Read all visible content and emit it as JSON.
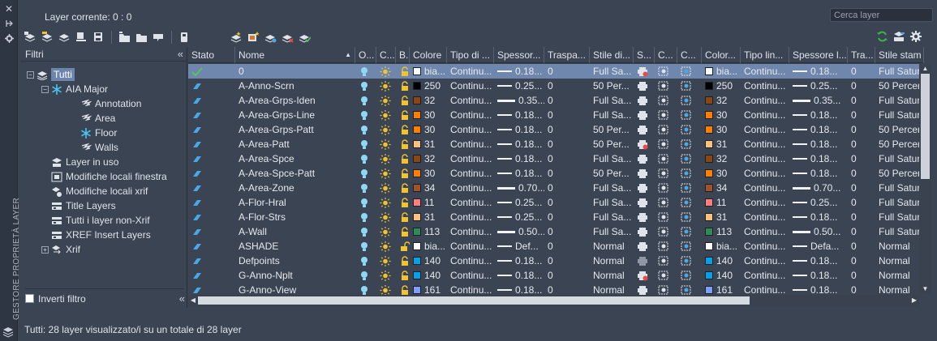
{
  "palette_title": "GESTORE PROPRIETÀ LAYER",
  "current_layer": "Layer corrente: 0 : 0",
  "search": {
    "placeholder": "Cerca layer"
  },
  "filters": {
    "header": "Filtri",
    "tree": [
      {
        "label": "Tutti",
        "level": 0,
        "expander": "−",
        "icon": "layers-icon",
        "selected": true
      },
      {
        "label": "AIA Major",
        "level": 1,
        "expander": "−",
        "icon": "snowflake-icon"
      },
      {
        "label": "Annotation",
        "level": 2,
        "icon": "layer-filter-icon"
      },
      {
        "label": "Area",
        "level": 2,
        "icon": "layer-filter-icon"
      },
      {
        "label": "Floor",
        "level": 2,
        "icon": "snowflake-icon"
      },
      {
        "label": "Walls",
        "level": 2,
        "icon": "layer-filter-icon"
      },
      {
        "label": "Layer in uso",
        "level": 1,
        "icon": "layers-in-use-icon"
      },
      {
        "label": "Modifiche locali finestra",
        "level": 1,
        "icon": "viewport-override-icon"
      },
      {
        "label": "Modifiche locali xrif",
        "level": 1,
        "icon": "xref-override-icon"
      },
      {
        "label": "Title Layers",
        "level": 1,
        "icon": "group-filter-icon"
      },
      {
        "label": "Tutti i layer non-Xrif",
        "level": 1,
        "icon": "group-filter-icon"
      },
      {
        "label": "XREF Insert Layers",
        "level": 1,
        "icon": "group-filter-icon"
      },
      {
        "label": "Xrif",
        "level": 1,
        "expander": "+",
        "icon": "xref-icon"
      }
    ],
    "invert_label": "Inverti filtro",
    "invert_checked": false
  },
  "columns": [
    "Stato",
    "Nome",
    "O...",
    "C...",
    "B.",
    "Colore",
    "Tipo di ...",
    "Spessor...",
    "Traspa...",
    "Stile di...",
    "S...",
    "C...",
    "C...",
    "Color...",
    "Tipo lin...",
    "Spessore l...",
    "Tra...",
    "Stile stam"
  ],
  "layers": [
    {
      "name": "0",
      "current": true,
      "color": "#ffffff",
      "color_label": "bia...",
      "linetype": "Continu...",
      "lw": "0.18...",
      "lw_thick": false,
      "transp": "0",
      "plot_style": "Full Sa...",
      "vp_color": "#ffffff",
      "vp_color_label": "bia...",
      "vp_linetype": "Continu...",
      "vp_lw": "0.18...",
      "vp_lw_thick": false,
      "vp_transp": "0",
      "vp_plot_style": "Full Satur",
      "plot": "noplot",
      "locked": true,
      "selected": true
    },
    {
      "name": "A-Anno-Scrn",
      "color": "#000000",
      "color_label": "250",
      "linetype": "Continu...",
      "lw": "0.25...",
      "lw_thick": false,
      "transp": "0",
      "plot_style": "50 Per...",
      "vp_color": "#000000",
      "vp_color_label": "250",
      "vp_linetype": "Continu...",
      "vp_lw": "0.25...",
      "vp_lw_thick": false,
      "vp_transp": "0",
      "vp_plot_style": "50 Percer",
      "plot": "plot",
      "locked": true
    },
    {
      "name": "A-Area-Grps-Iden",
      "color": "#8b4513",
      "color_label": "32",
      "linetype": "Continu...",
      "lw": "0.35...",
      "lw_thick": true,
      "transp": "0",
      "plot_style": "Full Sa...",
      "vp_color": "#8b4513",
      "vp_color_label": "32",
      "vp_linetype": "Continu...",
      "vp_lw": "0.35...",
      "vp_lw_thick": true,
      "vp_transp": "0",
      "vp_plot_style": "Full Satur",
      "plot": "plot",
      "locked": true
    },
    {
      "name": "A-Area-Grps-Line",
      "color": "#ff7f00",
      "color_label": "30",
      "linetype": "Continu...",
      "lw": "0.18...",
      "lw_thick": false,
      "transp": "0",
      "plot_style": "Full Sa...",
      "vp_color": "#ff7f00",
      "vp_color_label": "30",
      "vp_linetype": "Continu...",
      "vp_lw": "0.18...",
      "vp_lw_thick": false,
      "vp_transp": "0",
      "vp_plot_style": "Full Satur",
      "plot": "plot",
      "locked": true
    },
    {
      "name": "A-Area-Grps-Patt",
      "color": "#ff7f00",
      "color_label": "30",
      "linetype": "Continu...",
      "lw": "0.18...",
      "lw_thick": false,
      "transp": "0",
      "plot_style": "50 Per...",
      "vp_color": "#ff7f00",
      "vp_color_label": "30",
      "vp_linetype": "Continu...",
      "vp_lw": "0.18...",
      "vp_lw_thick": false,
      "vp_transp": "0",
      "vp_plot_style": "50 Percer",
      "plot": "plot",
      "locked": true
    },
    {
      "name": "A-Area-Patt",
      "color": "#ffbf7f",
      "color_label": "31",
      "linetype": "Continu...",
      "lw": "0.18...",
      "lw_thick": false,
      "transp": "0",
      "plot_style": "50 Per...",
      "vp_color": "#ffbf7f",
      "vp_color_label": "31",
      "vp_linetype": "Continu...",
      "vp_lw": "0.18...",
      "vp_lw_thick": false,
      "vp_transp": "0",
      "vp_plot_style": "50 Percer",
      "plot": "noplot",
      "locked": true
    },
    {
      "name": "A-Area-Spce",
      "color": "#8b4513",
      "color_label": "32",
      "linetype": "Continu...",
      "lw": "0.18...",
      "lw_thick": false,
      "transp": "0",
      "plot_style": "Full Sa...",
      "vp_color": "#8b4513",
      "vp_color_label": "32",
      "vp_linetype": "Continu...",
      "vp_lw": "0.18...",
      "vp_lw_thick": false,
      "vp_transp": "0",
      "vp_plot_style": "Full Satur",
      "plot": "plot",
      "locked": true
    },
    {
      "name": "A-Area-Spce-Patt",
      "color": "#ff7f00",
      "color_label": "30",
      "linetype": "Continu...",
      "lw": "0.18...",
      "lw_thick": false,
      "transp": "0",
      "plot_style": "50 Per...",
      "vp_color": "#ff7f00",
      "vp_color_label": "30",
      "vp_linetype": "Continu...",
      "vp_lw": "0.18...",
      "vp_lw_thick": false,
      "vp_transp": "0",
      "vp_plot_style": "50 Percer",
      "plot": "plot",
      "locked": true
    },
    {
      "name": "A-Area-Zone",
      "color": "#a0522d",
      "color_label": "34",
      "linetype": "Continu...",
      "lw": "0.70...",
      "lw_thick": true,
      "transp": "0",
      "plot_style": "Full Sa...",
      "vp_color": "#a0522d",
      "vp_color_label": "34",
      "vp_linetype": "Continu...",
      "vp_lw": "0.70...",
      "vp_lw_thick": true,
      "vp_transp": "0",
      "vp_plot_style": "Full Satur",
      "plot": "plot",
      "locked": true
    },
    {
      "name": "A-Flor-Hral",
      "color": "#ff7f7f",
      "color_label": "11",
      "linetype": "Continu...",
      "lw": "0.25...",
      "lw_thick": false,
      "transp": "0",
      "plot_style": "Full Sa...",
      "vp_color": "#ff7f7f",
      "vp_color_label": "11",
      "vp_linetype": "Continu...",
      "vp_lw": "0.25...",
      "vp_lw_thick": false,
      "vp_transp": "0",
      "vp_plot_style": "Full Satur",
      "plot": "plot",
      "locked": true
    },
    {
      "name": "A-Flor-Strs",
      "color": "#ffbf7f",
      "color_label": "31",
      "linetype": "Continu...",
      "lw": "0.25...",
      "lw_thick": false,
      "transp": "0",
      "plot_style": "Full Sa...",
      "vp_color": "#ffbf7f",
      "vp_color_label": "31",
      "vp_linetype": "Continu...",
      "vp_lw": "0.18...",
      "vp_lw_thick": false,
      "vp_transp": "0",
      "vp_plot_style": "Full Satur",
      "plot": "plot",
      "locked": true
    },
    {
      "name": "A-Wall",
      "color": "#2e8b57",
      "color_label": "113",
      "linetype": "Continu...",
      "lw": "0.50...",
      "lw_thick": true,
      "transp": "0",
      "plot_style": "Full Sa...",
      "vp_color": "#2e8b57",
      "vp_color_label": "113",
      "vp_linetype": "Continu...",
      "vp_lw": "0.50...",
      "vp_lw_thick": true,
      "vp_transp": "0",
      "vp_plot_style": "Full Satur",
      "plot": "plot",
      "locked": true
    },
    {
      "name": "ASHADE",
      "color": "#ffffff",
      "color_label": "bia...",
      "linetype": "Continu...",
      "lw": "Def...",
      "lw_thick": false,
      "transp": "0",
      "plot_style": "Normal",
      "vp_color": "#ffffff",
      "vp_color_label": "bia...",
      "vp_linetype": "Continu...",
      "vp_lw": "Defa...",
      "vp_lw_thick": false,
      "vp_transp": "0",
      "vp_plot_style": "Normal",
      "plot": "plot",
      "locked": false
    },
    {
      "name": "Defpoints",
      "color": "#0aa0e8",
      "color_label": "140",
      "linetype": "Continu...",
      "lw": "0.18...",
      "lw_thick": false,
      "transp": "0",
      "plot_style": "Normal",
      "vp_color": "#0aa0e8",
      "vp_color_label": "140",
      "vp_linetype": "Continu...",
      "vp_lw": "0.18...",
      "vp_lw_thick": false,
      "vp_transp": "0",
      "vp_plot_style": "Normal",
      "plot": "noplot-grey",
      "locked": true
    },
    {
      "name": "G-Anno-Nplt",
      "color": "#0aa0e8",
      "color_label": "140",
      "linetype": "Continu...",
      "lw": "0.18...",
      "lw_thick": false,
      "transp": "0",
      "plot_style": "Normal",
      "vp_color": "#0aa0e8",
      "vp_color_label": "140",
      "vp_linetype": "Continu...",
      "vp_lw": "0.18...",
      "vp_lw_thick": false,
      "vp_transp": "0",
      "vp_plot_style": "Normal",
      "plot": "noplot",
      "locked": true
    },
    {
      "name": "G-Anno-View",
      "color": "#7f9fff",
      "color_label": "161",
      "linetype": "Continu...",
      "lw": "0.18...",
      "lw_thick": false,
      "transp": "0",
      "plot_style": "Normal",
      "vp_color": "#7f9fff",
      "vp_color_label": "161",
      "vp_linetype": "Continu...",
      "vp_lw": "0.18...",
      "vp_lw_thick": false,
      "vp_transp": "0",
      "vp_plot_style": "Normal",
      "plot": "plot",
      "locked": true
    }
  ],
  "status": "Tutti: 28 layer visualizzato/i su un totale di 28 layer",
  "colors": {
    "background": "#3b4453",
    "selection": "#7087ad",
    "status_icon": "#49a8e8",
    "sun": "#f2c230",
    "lock": "#f2c230"
  }
}
